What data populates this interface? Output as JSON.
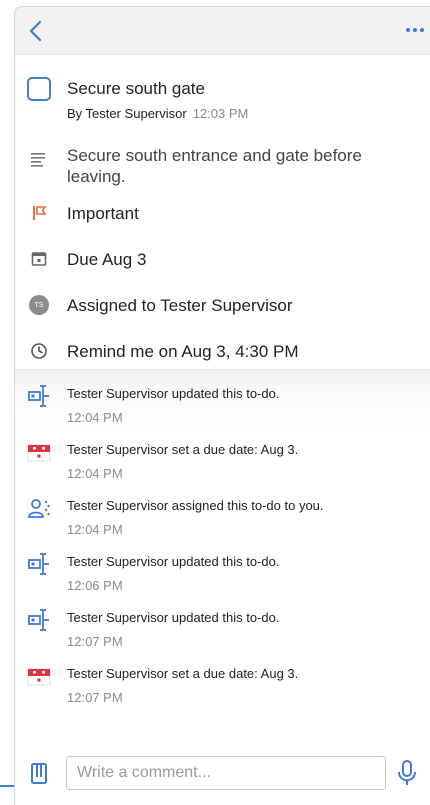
{
  "header": {
    "back_icon": "chevron-left-icon",
    "more_icon": "more-horizontal-icon"
  },
  "task": {
    "title": "Secure south gate",
    "by": "By Tester Supervisor",
    "created_time": "12:03 PM",
    "description": "Secure south entrance and gate before leaving.",
    "priority": "Important",
    "due": "Due Aug 3",
    "assignee_initials": "TS",
    "assigned": "Assigned to Tester Supervisor",
    "reminder": "Remind me on Aug 3, 4:30 PM"
  },
  "activity": [
    {
      "icon": "edit-task-icon",
      "text": "Tester Supervisor updated this to-do.",
      "time": "12:04 PM"
    },
    {
      "icon": "calendar-icon",
      "text": "Tester Supervisor set a due date: Aug 3.",
      "time": "12:04 PM"
    },
    {
      "icon": "assign-person-icon",
      "text": "Tester Supervisor assigned this to-do to you.",
      "time": "12:04 PM"
    },
    {
      "icon": "edit-task-icon",
      "text": "Tester Supervisor updated this to-do.",
      "time": "12:06 PM"
    },
    {
      "icon": "edit-task-icon",
      "text": "Tester Supervisor updated this to-do.",
      "time": "12:07 PM"
    },
    {
      "icon": "calendar-icon",
      "text": "Tester Supervisor set a due date: Aug 3.",
      "time": "12:07 PM"
    }
  ],
  "composer": {
    "placeholder": "Write a comment..."
  },
  "colors": {
    "accent": "#3d7bd9",
    "flag": "#e8703a",
    "calendar_red": "#d9343a",
    "text": "#222222",
    "muted": "#8a8a8a"
  }
}
